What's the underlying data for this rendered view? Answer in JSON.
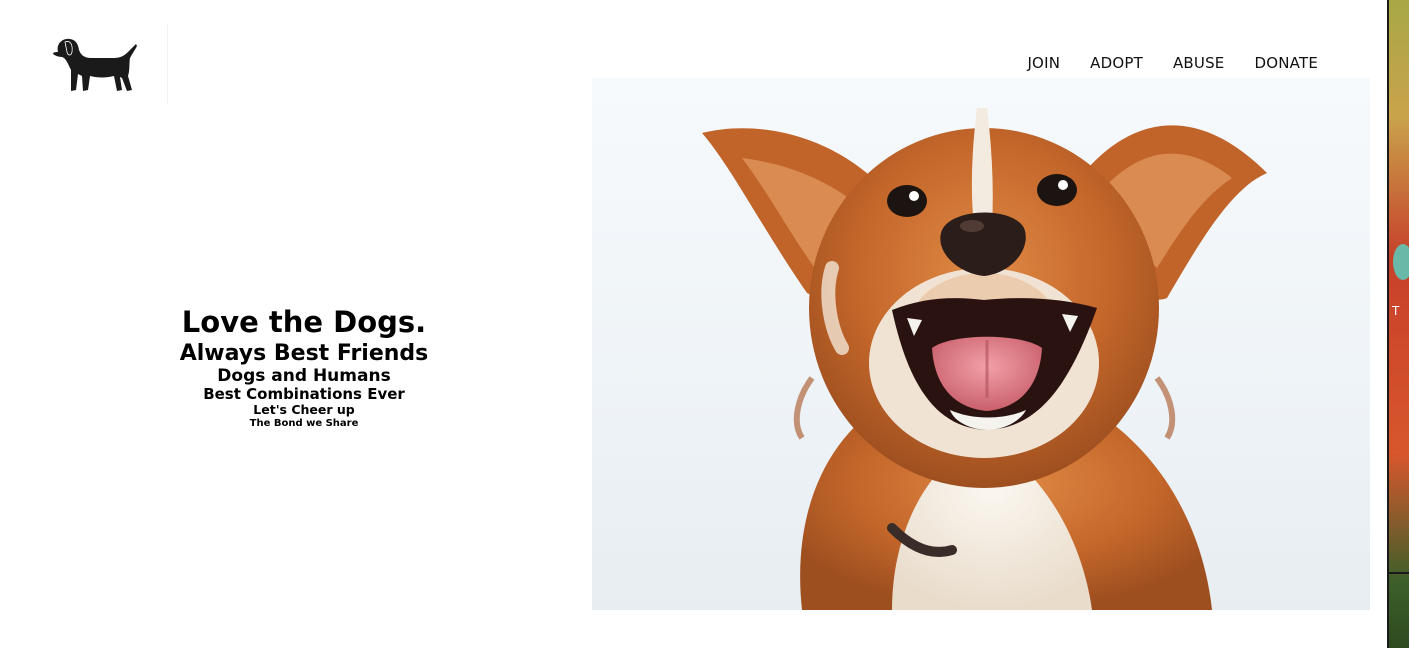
{
  "header": {
    "logo_icon": "dog-silhouette-icon",
    "nav": [
      {
        "label": "JOIN"
      },
      {
        "label": "ADOPT"
      },
      {
        "label": "ABUSE"
      },
      {
        "label": "DONATE"
      }
    ]
  },
  "hero": {
    "lines": [
      "Love the Dogs.",
      "Always Best Friends",
      "Dogs and Humans",
      "Best Combinations Ever",
      "Let's Cheer up",
      "The Bond we Share"
    ],
    "image": "smiling-puppy-photo"
  },
  "edge_slide": {
    "letter": "T"
  },
  "colors": {
    "background": "#ffffff",
    "text": "#000000",
    "dog_fur": "#c4672b",
    "dog_fur_light": "#f5efe6"
  }
}
